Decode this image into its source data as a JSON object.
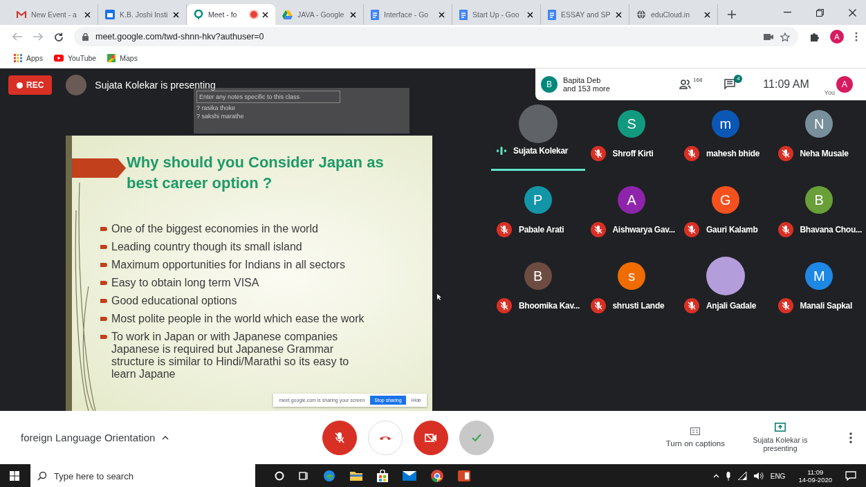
{
  "browser": {
    "tabs": [
      {
        "title": "New Event - a",
        "kind": "mail",
        "selected": false,
        "recording": false
      },
      {
        "title": "K.B. Joshi Insti",
        "kind": "calendar",
        "selected": false,
        "recording": false
      },
      {
        "title": "Meet - fo",
        "kind": "meet",
        "selected": true,
        "recording": true
      },
      {
        "title": "JAVA - Google",
        "kind": "drive",
        "selected": false,
        "recording": false
      },
      {
        "title": "Interface - Go",
        "kind": "doc",
        "selected": false,
        "recording": false
      },
      {
        "title": "Start Up - Goo",
        "kind": "doc",
        "selected": false,
        "recording": false
      },
      {
        "title": "ESSAY and SP",
        "kind": "doc",
        "selected": false,
        "recording": false
      },
      {
        "title": "eduCloud.in",
        "kind": "globe",
        "selected": false,
        "recording": false
      }
    ],
    "url": "meet.google.com/twd-shnn-hkv?authuser=0",
    "profile_initial": "A",
    "bookmarks": [
      {
        "label": "Apps",
        "kind": "apps"
      },
      {
        "label": "YouTube",
        "kind": "youtube"
      },
      {
        "label": "Maps",
        "kind": "maps"
      }
    ]
  },
  "meet": {
    "rec_label": "REC",
    "presenter_text": "Sujata Kolekar is presenting",
    "notes_panel": {
      "placeholder": "Enter any notes specific to this class",
      "names": [
        "? rasika thoke",
        "? sakshi marathe"
      ]
    },
    "people_chip": {
      "initial": "B",
      "line_1": "Bapita Deb",
      "line_2": "and 153 more"
    },
    "people_count": "168",
    "chat_badge": "4",
    "time": "11:09 AM",
    "self_label": "You",
    "self_initial": "A",
    "slide": {
      "title": "Why should you Consider Japan as best career option ?",
      "bullets": [
        "One of the biggest economies in the world",
        "Leading country though its small island",
        "Maximum opportunities for Indians in all sectors",
        "Easy to obtain  long term VISA",
        "Good educational options",
        "Most polite  people in the world which ease the work",
        "To work in Japan or with Japanese companies Japanese is required  but Japanese Grammar structure is similar to Hindi/Marathi so its easy to learn Japane"
      ]
    },
    "share_bar": {
      "message": "meet.google.com is sharing your screen",
      "stop": "Stop sharing",
      "hide": "Hide"
    },
    "participants": [
      {
        "name": "Sujata Kolekar",
        "kind": "photo",
        "color": "#5f6368",
        "muted": false,
        "selected": true
      },
      {
        "name": "Shroff Kirti",
        "kind": "initial",
        "initial": "S",
        "color": "#129a7f",
        "muted": true,
        "selected": false
      },
      {
        "name": "mahesh bhide",
        "kind": "initial",
        "initial": "m",
        "color": "#0b57b5",
        "muted": true,
        "selected": false
      },
      {
        "name": "Neha Musale",
        "kind": "initial",
        "initial": "N",
        "color": "#78909c",
        "muted": true,
        "selected": false
      },
      {
        "name": "Pabale Arati",
        "kind": "initial",
        "initial": "P",
        "color": "#1395a8",
        "muted": true,
        "selected": false
      },
      {
        "name": "Aishwarya Gav...",
        "kind": "initial",
        "initial": "A",
        "color": "#8e24aa",
        "muted": true,
        "selected": false
      },
      {
        "name": "Gauri Kalamb",
        "kind": "initial",
        "initial": "G",
        "color": "#f4511e",
        "muted": true,
        "selected": false
      },
      {
        "name": "Bhavana Chou...",
        "kind": "initial",
        "initial": "B",
        "color": "#689f38",
        "muted": true,
        "selected": false
      },
      {
        "name": "Bhoomika Kav...",
        "kind": "initial",
        "initial": "B",
        "color": "#6d4c41",
        "muted": true,
        "selected": false
      },
      {
        "name": "shrusti Lande",
        "kind": "initial",
        "initial": "s",
        "color": "#ef6c00",
        "muted": true,
        "selected": false
      },
      {
        "name": "Anjali Gadale",
        "kind": "photo",
        "color": "#b39ddb",
        "muted": true,
        "selected": false
      },
      {
        "name": "Manali Sapkal",
        "kind": "initial",
        "initial": "M",
        "color": "#1e88e5",
        "muted": true,
        "selected": false
      }
    ],
    "meeting_name": "foreign Language Orientation",
    "controls": [
      {
        "kind": "mic",
        "on": false
      },
      {
        "kind": "hangup",
        "on": true
      },
      {
        "kind": "camera",
        "on": false
      },
      {
        "kind": "check",
        "on": true
      }
    ],
    "captions_label": "Turn on captions",
    "presenting_label": "Sujata Kolekar is presenting"
  },
  "taskbar": {
    "search_placeholder": "Type here to search",
    "language": "ENG",
    "time": "11:09",
    "date": "14-09-2020"
  }
}
